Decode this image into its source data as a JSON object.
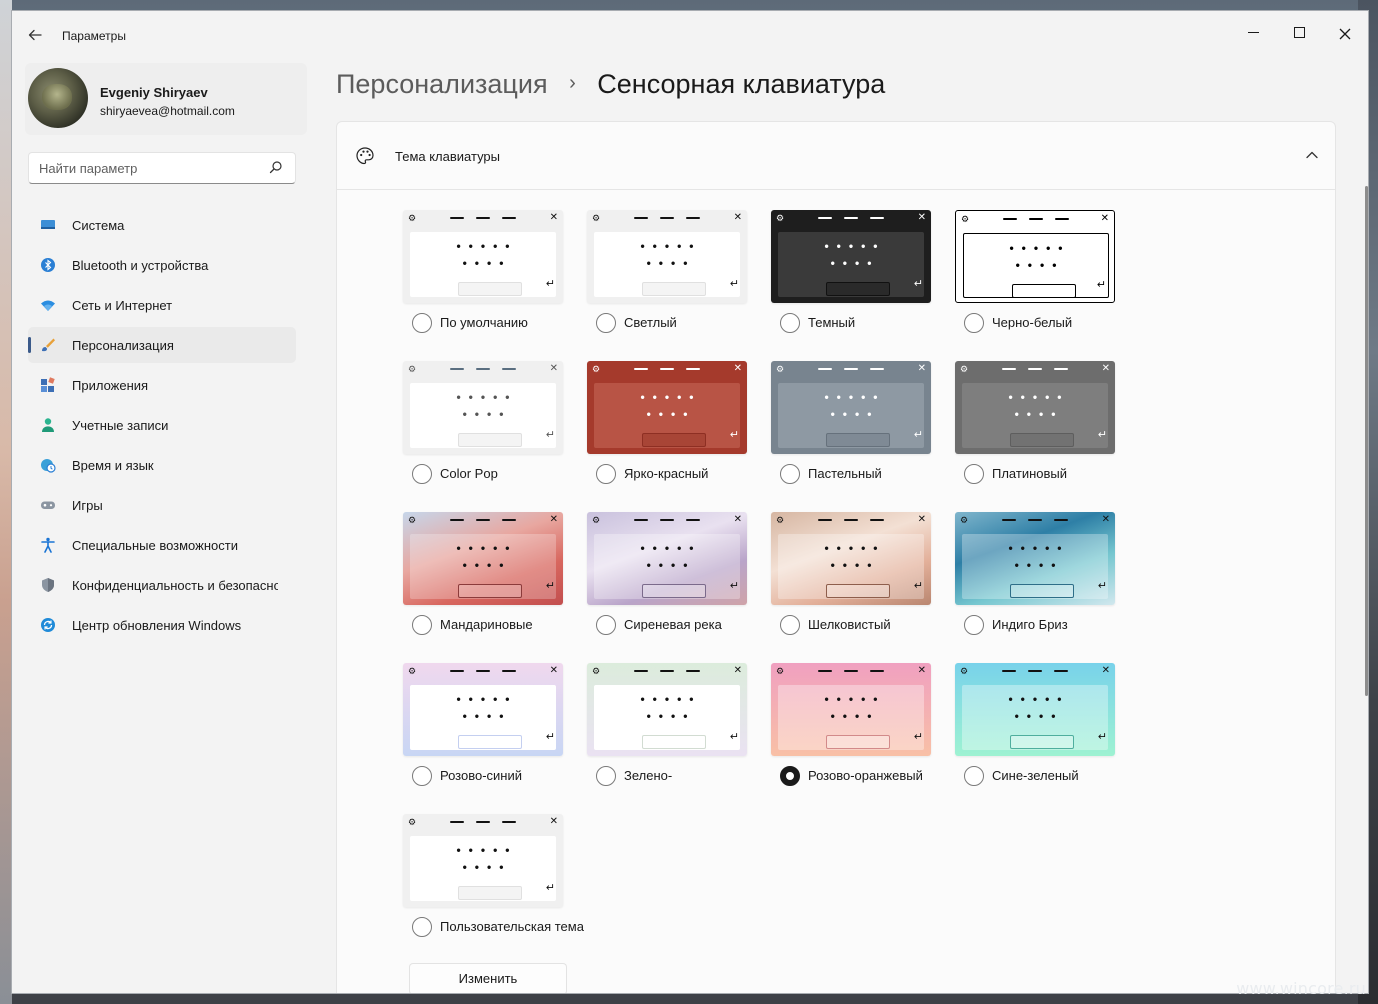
{
  "window": {
    "title": "Параметры"
  },
  "profile": {
    "name": "Evgeniy Shiryaev",
    "email": "shiryaevea@hotmail.com"
  },
  "search": {
    "placeholder": "Найти параметр"
  },
  "nav": [
    {
      "id": "system",
      "label": "Система",
      "icon": "monitor-icon",
      "active": false
    },
    {
      "id": "bluetooth",
      "label": "Bluetooth и устройства",
      "icon": "bluetooth-icon",
      "active": false
    },
    {
      "id": "network",
      "label": "Сеть и Интернет",
      "icon": "wifi-icon",
      "active": false
    },
    {
      "id": "personalization",
      "label": "Персонализация",
      "icon": "brush-icon",
      "active": true
    },
    {
      "id": "apps",
      "label": "Приложения",
      "icon": "apps-icon",
      "active": false
    },
    {
      "id": "accounts",
      "label": "Учетные записи",
      "icon": "person-icon",
      "active": false
    },
    {
      "id": "time",
      "label": "Время и язык",
      "icon": "globe-clock-icon",
      "active": false
    },
    {
      "id": "gaming",
      "label": "Игры",
      "icon": "gamepad-icon",
      "active": false
    },
    {
      "id": "accessibility",
      "label": "Специальные возможности",
      "icon": "accessibility-icon",
      "active": false
    },
    {
      "id": "privacy",
      "label": "Конфиденциальность и безопасность",
      "icon": "shield-icon",
      "active": false
    },
    {
      "id": "update",
      "label": "Центр обновления Windows",
      "icon": "update-icon",
      "active": false
    }
  ],
  "breadcrumb": {
    "parent": "Персонализация",
    "separator": "›",
    "current": "Сенсорная клавиатура"
  },
  "section": {
    "title": "Тема клавиатуры",
    "expanded": true
  },
  "themes": [
    {
      "id": "default",
      "label": "По умолчанию",
      "selected": false,
      "frame": "#f0f0f0",
      "body": "#ffffff",
      "fg": "#111111",
      "bar": "#f4f4f4",
      "barBorder": "#e0e0e0"
    },
    {
      "id": "light",
      "label": "Светлый",
      "selected": false,
      "frame": "#f0f0f0",
      "body": "#ffffff",
      "fg": "#111111",
      "bar": "#f4f4f4",
      "barBorder": "#e0e0e0"
    },
    {
      "id": "dark",
      "label": "Темный",
      "selected": false,
      "frame": "#1e1e1e",
      "body": "#3a3a3a",
      "fg": "#ffffff",
      "bar": "#2a2a2a",
      "barBorder": "#111111"
    },
    {
      "id": "bw",
      "label": "Черно-белый",
      "selected": false,
      "frame": "#ffffff",
      "body": "#ffffff",
      "fg": "#000000",
      "bar": "#ffffff",
      "barBorder": "#000000",
      "outline": true
    },
    {
      "id": "colorpop",
      "label": "Color Pop",
      "selected": false,
      "frame": "#f0f0f0",
      "body": "#ffffff",
      "fg": "#555555",
      "bar": "#f4f4f4",
      "barBorder": "#e0e0e0",
      "dashColor": "#5a6e80"
    },
    {
      "id": "red",
      "label": "Ярко-красный",
      "selected": false,
      "frame": "#a53a2c",
      "body": "#b85445",
      "fg": "#ffffff",
      "bar": "#a84536",
      "barBorder": "#8e2f23"
    },
    {
      "id": "pastel",
      "label": "Пастельный",
      "selected": false,
      "frame": "#78848f",
      "body": "#8e99a3",
      "fg": "#ffffff",
      "bar": "#7f8a95",
      "barBorder": "#66717c"
    },
    {
      "id": "platinum",
      "label": "Платиновый",
      "selected": false,
      "frame": "#6d6d6d",
      "body": "#7e7e7e",
      "fg": "#ffffff",
      "bar": "#727272",
      "barBorder": "#5e5e5e"
    },
    {
      "id": "tangerine",
      "label": "Мандариновые",
      "selected": false,
      "frame": "linear-gradient(160deg,#c6d6ea 0%,#e8a7a0 40%,#d8675f 70%,#c24e4e 100%)",
      "body": "rgba(255,255,255,0.25)",
      "fg": "#111111",
      "bar": "rgba(255,255,255,0.2)",
      "barBorder": "#8b3b3b"
    },
    {
      "id": "lilac",
      "label": "Сиреневая река",
      "selected": false,
      "frame": "linear-gradient(160deg,#c9c1dd 0%,#e9e1f0 40%,#b9a4c9 70%,#cfa3a8 100%)",
      "body": "rgba(255,255,255,0.3)",
      "fg": "#111111",
      "bar": "rgba(255,255,255,0.25)",
      "barBorder": "#7b6a8b"
    },
    {
      "id": "silky",
      "label": "Шелковистый",
      "selected": false,
      "frame": "linear-gradient(160deg,#d6b6a2 0%,#f3e0d4 40%,#e3b09a 70%,#b98670 100%)",
      "body": "rgba(255,255,255,0.3)",
      "fg": "#111111",
      "bar": "rgba(255,255,255,0.25)",
      "barBorder": "#8e5e4c"
    },
    {
      "id": "indigo",
      "label": "Индиго Бриз",
      "selected": false,
      "frame": "linear-gradient(160deg,#7fb5cc 0%,#2e7fa6 35%,#75c6cf 65%,#d2e8ee 100%)",
      "body": "rgba(255,255,255,0.3)",
      "fg": "#111111",
      "bar": "rgba(255,255,255,0.25)",
      "barBorder": "#2e6e88"
    },
    {
      "id": "pinkblue",
      "label": "Розово-синий",
      "selected": false,
      "frame": "linear-gradient(180deg,#f0d8ee 0%,#c8d6f4 100%)",
      "body": "#ffffff",
      "fg": "#111111",
      "bar": "#ffffff",
      "barBorder": "#c4cff0"
    },
    {
      "id": "green",
      "label": "Зелено-",
      "selected": false,
      "frame": "linear-gradient(180deg,#dcecdc 0%,#eae2f2 100%)",
      "body": "#ffffff",
      "fg": "#111111",
      "bar": "#ffffff",
      "barBorder": "#d2dcd2"
    },
    {
      "id": "pinkorange",
      "label": "Розово-оранжевый",
      "selected": true,
      "frame": "linear-gradient(180deg,#f0a0c0 0%,#f8c0a6 100%)",
      "body": "rgba(255,255,255,0.35)",
      "fg": "#111111",
      "bar": "rgba(255,255,255,0.3)",
      "barBorder": "#d28a8a"
    },
    {
      "id": "bluegreen",
      "label": "Сине-зеленый",
      "selected": false,
      "frame": "linear-gradient(180deg,#78d2ea 0%,#9ef2d2 100%)",
      "body": "rgba(255,255,255,0.35)",
      "fg": "#111111",
      "bar": "rgba(255,255,255,0.3)",
      "barBorder": "#4fae9e"
    },
    {
      "id": "custom",
      "label": "Пользовательская тема",
      "selected": false,
      "frame": "#f0f0f0",
      "body": "#ffffff",
      "fg": "#111111",
      "bar": "#f4f4f4",
      "barBorder": "#e0e0e0"
    }
  ],
  "edit_button": {
    "label": "Изменить"
  },
  "watermark": "www.wincore.ru"
}
